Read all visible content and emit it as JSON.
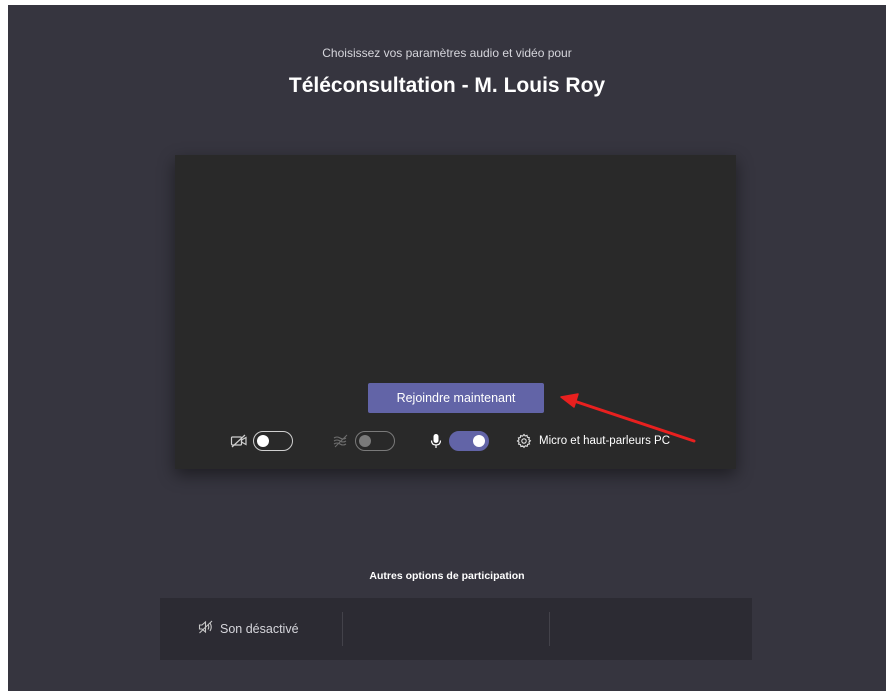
{
  "header": {
    "subtitle": "Choisissez vos paramètres audio et vidéo pour",
    "meeting_title": "Téléconsultation - M. Louis Roy"
  },
  "preview": {
    "join_button_label": "Rejoindre maintenant",
    "controls": {
      "camera": {
        "icon": "camera-off-icon",
        "enabled": false
      },
      "background_blur": {
        "icon": "background-blur-icon",
        "enabled": false,
        "disabled": true
      },
      "microphone": {
        "icon": "microphone-icon",
        "enabled": true
      },
      "device_settings": {
        "icon": "gear-icon",
        "label": "Micro et haut-parleurs PC"
      }
    }
  },
  "other_options": {
    "heading": "Autres options de participation",
    "items": [
      {
        "icon": "speaker-off-icon",
        "label": "Son désactivé"
      }
    ]
  },
  "colors": {
    "background": "#36353f",
    "preview": "#292929",
    "accent": "#6264a7",
    "annotation_arrow": "#e8201f"
  }
}
